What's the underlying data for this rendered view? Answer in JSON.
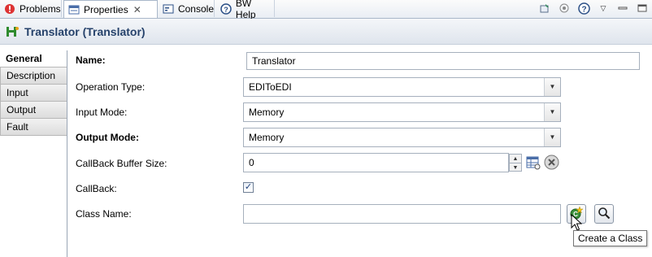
{
  "tabs": [
    {
      "label": "Problems",
      "icon": "problems-icon"
    },
    {
      "label": "Properties",
      "icon": "properties-icon",
      "active": true
    },
    {
      "label": "Console",
      "icon": "console-icon"
    },
    {
      "label": "BW Help",
      "icon": "help-icon"
    }
  ],
  "toolbar_icons": [
    "pin-icon",
    "filter-icon",
    "help-icon",
    "view-menu-icon",
    "minimize-icon",
    "maximize-icon"
  ],
  "header": {
    "title": "Translator (Translator)",
    "icon": "translator-icon"
  },
  "side_tabs": [
    "General",
    "Description",
    "Input",
    "Output",
    "Fault"
  ],
  "form": {
    "name_label": "Name:",
    "name_value": "Translator",
    "operation_type_label": "Operation Type:",
    "operation_type_value": "EDIToEDI",
    "input_mode_label": "Input Mode:",
    "input_mode_value": "Memory",
    "output_mode_label": "Output Mode:",
    "output_mode_value": "Memory",
    "callback_buffer_label": "CallBack Buffer Size:",
    "callback_buffer_value": "0",
    "callback_label": "CallBack:",
    "callback_checked": true,
    "class_name_label": "Class Name:",
    "class_name_value": ""
  },
  "tooltip": "Create a Class",
  "colors": {
    "header_title": "#26426b",
    "tab_border": "#a9b7c9"
  }
}
